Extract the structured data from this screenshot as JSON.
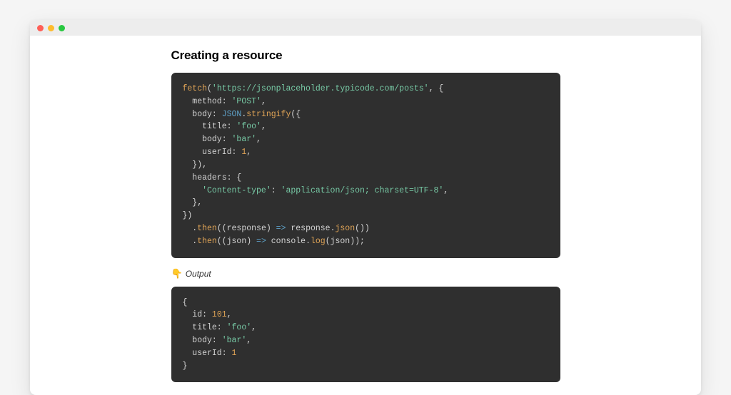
{
  "heading": "Creating a resource",
  "output_label": "Output",
  "emoji": "👇",
  "code1": {
    "t1_fn": "fetch",
    "t1_paren": "(",
    "t1_url": "'https://jsonplaceholder.typicode.com/posts'",
    "t1_after": ", {",
    "t2_key": "  method: ",
    "t2_val": "'POST'",
    "t2_comma": ",",
    "t3_key": "  body: ",
    "t3_json": "JSON",
    "t3_dot": ".",
    "t3_stringify": "stringify",
    "t3_open": "({",
    "t4_key": "    title: ",
    "t4_val": "'foo'",
    "t4_comma": ",",
    "t5_key": "    body: ",
    "t5_val": "'bar'",
    "t5_comma": ",",
    "t6_key": "    userId: ",
    "t6_val": "1",
    "t6_comma": ",",
    "t7": "  }),",
    "t8": "  headers: {",
    "t9_key": "    ",
    "t9_hkey": "'Content-type'",
    "t9_colon": ": ",
    "t9_hval": "'application/json; charset=UTF-8'",
    "t9_comma": ",",
    "t10": "  },",
    "t11": "})",
    "t12_dot": "  .",
    "t12_then": "then",
    "t12_open": "((response) ",
    "t12_arrow": "=>",
    "t12_mid": " response.",
    "t12_json": "json",
    "t12_close": "())",
    "t13_dot": "  .",
    "t13_then": "then",
    "t13_open": "((json) ",
    "t13_arrow": "=>",
    "t13_mid": " console.",
    "t13_log": "log",
    "t13_close": "(json));"
  },
  "code2": {
    "l1": "{",
    "l2_key": "  id: ",
    "l2_val": "101",
    "l2_comma": ",",
    "l3_key": "  title: ",
    "l3_val": "'foo'",
    "l3_comma": ",",
    "l4_key": "  body: ",
    "l4_val": "'bar'",
    "l4_comma": ",",
    "l5_key": "  userId: ",
    "l5_val": "1",
    "l6": "}"
  }
}
